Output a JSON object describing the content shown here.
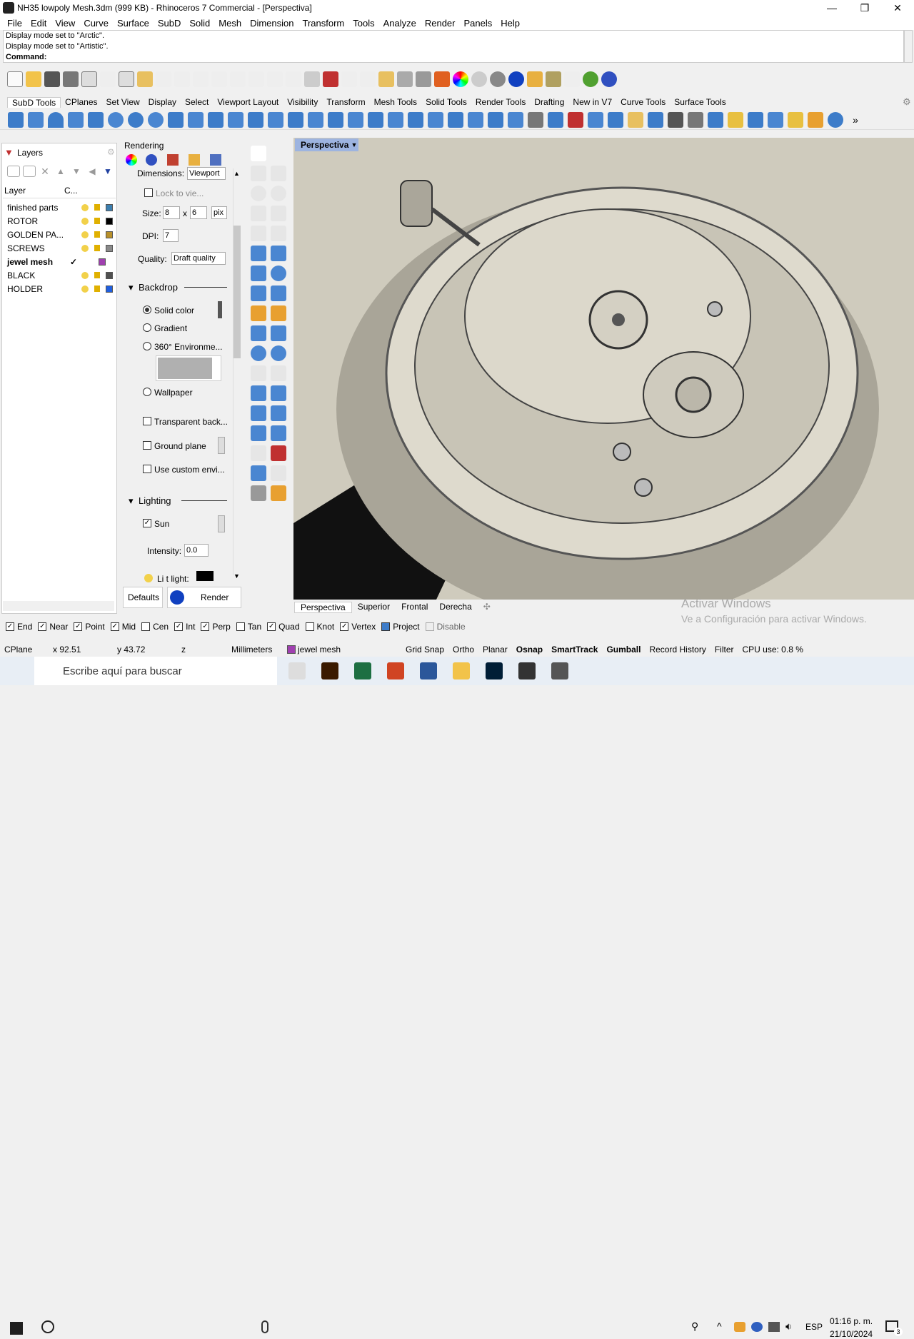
{
  "window": {
    "title": "NH35 lowpoly Mesh.3dm (999 KB) - Rhinoceros 7 Commercial - [Perspectiva]"
  },
  "menu": [
    "File",
    "Edit",
    "View",
    "Curve",
    "Surface",
    "SubD",
    "Solid",
    "Mesh",
    "Dimension",
    "Transform",
    "Tools",
    "Analyze",
    "Render",
    "Panels",
    "Help"
  ],
  "command": {
    "history1": "Display mode set to \"Arctic\".",
    "history2": "Display mode set to \"Artistic\".",
    "prompt": "Command:"
  },
  "toolbar_tabs": [
    "SubD Tools",
    "CPlanes",
    "Set View",
    "Display",
    "Select",
    "Viewport Layout",
    "Visibility",
    "Transform",
    "Mesh Tools",
    "Solid Tools",
    "Render Tools",
    "Drafting",
    "New in V7",
    "Curve Tools",
    "Surface Tools"
  ],
  "layers": {
    "title": "Layers",
    "col_layer": "Layer",
    "col_color": "C...",
    "rows": [
      {
        "name": "finished parts",
        "color": "#3c7fb0"
      },
      {
        "name": "ROTOR",
        "color": "#000000"
      },
      {
        "name": "GOLDEN PA...",
        "color": "#b8902a"
      },
      {
        "name": "SCREWS",
        "color": "#8a8a8a"
      },
      {
        "name": "jewel mesh",
        "color": "#a040b0",
        "current": "✓"
      },
      {
        "name": "BLACK",
        "color": "#505050"
      },
      {
        "name": "HOLDER",
        "color": "#1f5fe0"
      }
    ]
  },
  "rendering": {
    "title": "Rendering",
    "dimensions_label": "Dimensions:",
    "dimensions_value": "Viewport",
    "lock_label": "Lock to vie...",
    "size_label": "Size:",
    "size_w": "8",
    "size_x": "x",
    "size_h": "6",
    "size_unit": "pix",
    "dpi_label": "DPI:",
    "dpi_value": "7",
    "quality_label": "Quality:",
    "quality_value": "Draft quality",
    "backdrop": "Backdrop",
    "solid_color": "Solid color",
    "gradient": "Gradient",
    "env360": "360° Environme...",
    "wallpaper": "Wallpaper",
    "transparent": "Transparent back...",
    "ground": "Ground plane",
    "custom_env": "Use custom envi...",
    "lighting": "Lighting",
    "sun": "Sun",
    "intensity_label": "Intensity:",
    "intensity_value": "0.0",
    "light_label": "Li   t light:",
    "defaults_btn": "Defaults",
    "render_btn": "Render"
  },
  "viewport": {
    "title": "Perspectiva",
    "tabs": [
      "Perspectiva",
      "Superior",
      "Frontal",
      "Derecha"
    ],
    "add_tab": "✣"
  },
  "watermark": {
    "line1": "Activar Windows",
    "line2": "Ve a Configuración para activar Windows."
  },
  "osnap": [
    "End",
    "Near",
    "Point",
    "Mid",
    "Cen",
    "Int",
    "Perp",
    "Tan",
    "Quad",
    "Knot",
    "Vertex",
    "Project",
    "Disable"
  ],
  "osnap_checked": [
    true,
    true,
    true,
    true,
    false,
    true,
    true,
    false,
    true,
    false,
    true,
    true,
    false
  ],
  "status": {
    "cplane": "CPlane",
    "x": "x 92.51",
    "y": "y 43.72",
    "z": "z",
    "units": "Millimeters",
    "layer": "jewel mesh",
    "grid_snap": "Grid Snap",
    "ortho": "Ortho",
    "planar": "Planar",
    "osnap": "Osnap",
    "smarttrack": "SmartTrack",
    "gumball": "Gumball",
    "history": "Record History",
    "filter": "Filter",
    "cpu": "CPU use: 0.8 %"
  },
  "taskbar": {
    "search": "Escribe aquí para buscar",
    "lang": "ESP",
    "time": "01:16 p. m.",
    "date": "21/10/2024",
    "notif": "3"
  }
}
